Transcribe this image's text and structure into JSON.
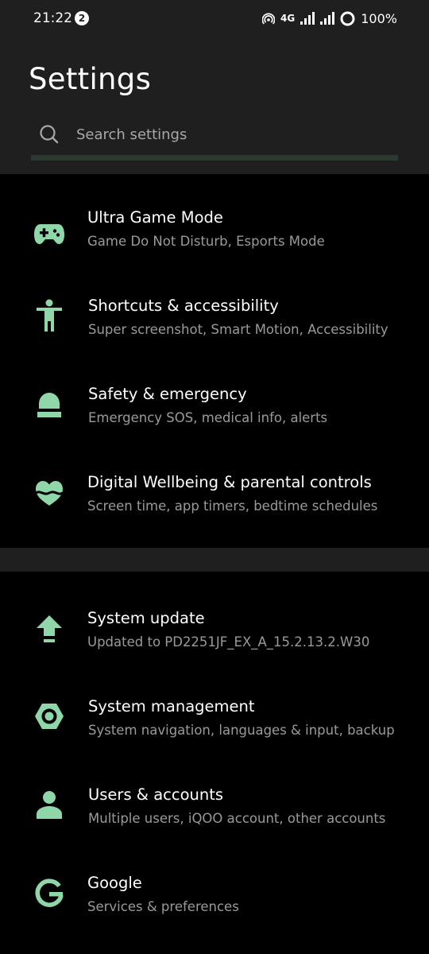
{
  "status_bar": {
    "time": "21:22",
    "notification_count": "2",
    "network": "4G",
    "battery": "100%"
  },
  "header": {
    "title": "Settings"
  },
  "search": {
    "placeholder": "Search settings"
  },
  "theme": {
    "accent": "#8fd6a8",
    "background": "#000000",
    "header_background": "#1f1f1f",
    "subtitle_color": "#9a9a9a"
  },
  "groups": [
    {
      "items": [
        {
          "icon": "gamepad-icon",
          "title": "Ultra Game Mode",
          "subtitle": "Game Do Not Disturb, Esports Mode"
        },
        {
          "icon": "accessibility-icon",
          "title": "Shortcuts & accessibility",
          "subtitle": "Super screenshot, Smart Motion, Accessibility"
        },
        {
          "icon": "emergency-light-icon",
          "title": "Safety & emergency",
          "subtitle": "Emergency SOS, medical info, alerts"
        },
        {
          "icon": "heart-icon",
          "title": "Digital Wellbeing & parental controls",
          "subtitle": "Screen time, app timers, bedtime schedules"
        }
      ]
    },
    {
      "items": [
        {
          "icon": "system-update-icon",
          "title": "System update",
          "subtitle": "Updated to PD2251JF_EX_A_15.2.13.2.W30"
        },
        {
          "icon": "hexagon-nut-icon",
          "title": "System management",
          "subtitle": "System navigation, languages & input, backup"
        },
        {
          "icon": "person-icon",
          "title": "Users & accounts",
          "subtitle": "Multiple users, iQOO account, other accounts"
        },
        {
          "icon": "google-g-icon",
          "title": "Google",
          "subtitle": "Services & preferences"
        }
      ]
    }
  ]
}
